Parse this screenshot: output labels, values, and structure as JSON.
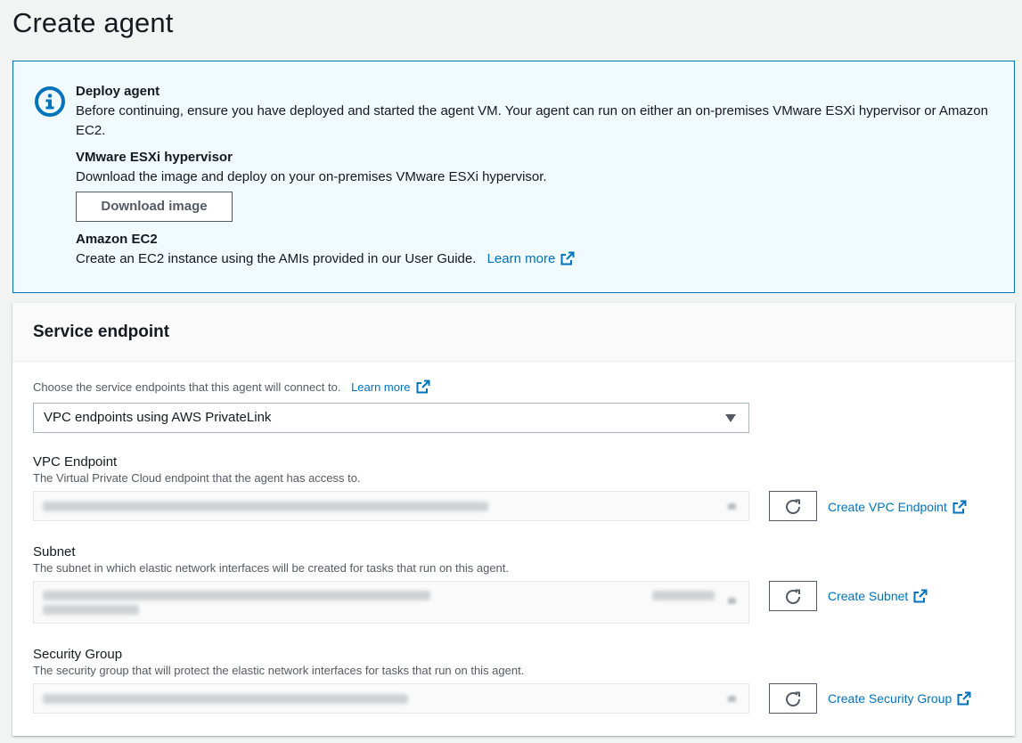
{
  "page": {
    "title": "Create agent"
  },
  "alert": {
    "heading": "Deploy agent",
    "text": "Before continuing, ensure you have deployed and started the agent VM. Your agent can run on either an on-premises VMware ESXi hypervisor or Amazon EC2.",
    "vmware": {
      "heading": "VMware ESXi hypervisor",
      "text": "Download the image and deploy on your on-premises VMware ESXi hypervisor.",
      "button_label": "Download image"
    },
    "ec2": {
      "heading": "Amazon EC2",
      "text": "Create an EC2 instance using the AMIs provided in our User Guide.",
      "link_label": "Learn more"
    },
    "icon": "info-icon"
  },
  "service_endpoint": {
    "title": "Service endpoint",
    "hint": "Choose the service endpoints that this agent will connect to.",
    "hint_link": "Learn more",
    "selected_value": "VPC endpoints using AWS PrivateLink",
    "vpc_endpoint": {
      "label": "VPC Endpoint",
      "description": "The Virtual Private Cloud endpoint that the agent has access to.",
      "create_link": "Create VPC Endpoint"
    },
    "subnet": {
      "label": "Subnet",
      "description": "The subnet in which elastic network interfaces will be created for tasks that run on this agent.",
      "create_link": "Create Subnet"
    },
    "security_group": {
      "label": "Security Group",
      "description": "The security group that will protect the elastic network interfaces for tasks that run on this agent.",
      "create_link": "Create Security Group"
    }
  },
  "colors": {
    "link": "#0073bb",
    "alert_border": "#0073bb",
    "alert_bg": "#f1faff",
    "text": "#16191f",
    "muted": "#545b64"
  }
}
